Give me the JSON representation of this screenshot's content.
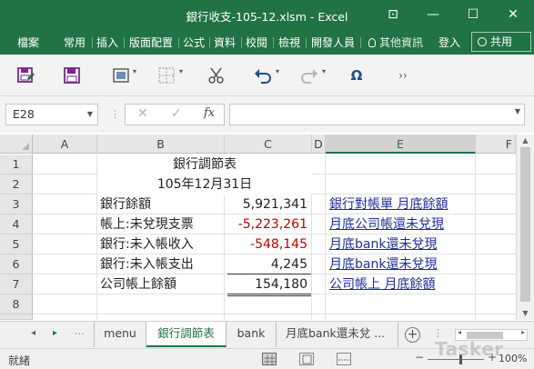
{
  "window": {
    "title": "銀行收支-105-12.xlsm - Excel",
    "controls": {
      "ribbon_display": "⊡",
      "minimize": "—",
      "maximize": "☐",
      "close": "✕"
    }
  },
  "ribbon": {
    "tabs": [
      "檔案",
      "常用",
      "插入",
      "版面配置",
      "公式",
      "資料",
      "校閱",
      "檢視",
      "開發人員"
    ],
    "tell_me": "其他資訊",
    "sign_in": "登入",
    "share": "共用"
  },
  "quick_access": {
    "icons": [
      "save-as-icon",
      "save-icon",
      "layout-icon",
      "borders-icon",
      "cut-icon",
      "undo-icon",
      "redo-icon",
      "symbol-icon",
      "more-icon"
    ],
    "symbol_glyph": "Ω",
    "more_glyph": "››"
  },
  "formula_bar": {
    "name_box": "E28",
    "cancel": "✕",
    "enter": "✓",
    "fx": "fx",
    "formula": ""
  },
  "grid": {
    "columns": [
      "A",
      "B",
      "C",
      "D",
      "E",
      "F"
    ],
    "selected_column": "E",
    "rows": [
      "1",
      "2",
      "3",
      "4",
      "5",
      "6",
      "7",
      "8"
    ],
    "cells": {
      "B1": "銀行調節表",
      "B2": "105年12月31日",
      "B3": "銀行餘額",
      "C3": "5,921,341",
      "E3": "銀行對帳單 月底餘額",
      "B4": "帳上:未兌現支票",
      "C4": "-5,223,261",
      "E4": "月底公司帳還未兌現",
      "B5": "銀行:未入帳收入",
      "C5": "-548,145",
      "E5": "月底bank還未兌現",
      "B6": "銀行:未入帳支出",
      "C6": "4,245",
      "E6": "月底bank還未兌現",
      "B7": "公司帳上餘額",
      "C7": "154,180",
      "E7": "公司帳上 月底餘額"
    },
    "colors": {
      "negative": "#c00000",
      "link": "#1f2fa0",
      "accent": "#217346"
    }
  },
  "sheets": {
    "tabs": [
      "menu",
      "銀行調節表",
      "bank",
      "月底bank還未兌 ..."
    ],
    "active": "銀行調節表",
    "add_glyph": "+"
  },
  "status": {
    "mode": "就緒",
    "zoom": "100%",
    "zoom_minus": "−",
    "zoom_plus": "+",
    "watermark": "Tasker"
  }
}
